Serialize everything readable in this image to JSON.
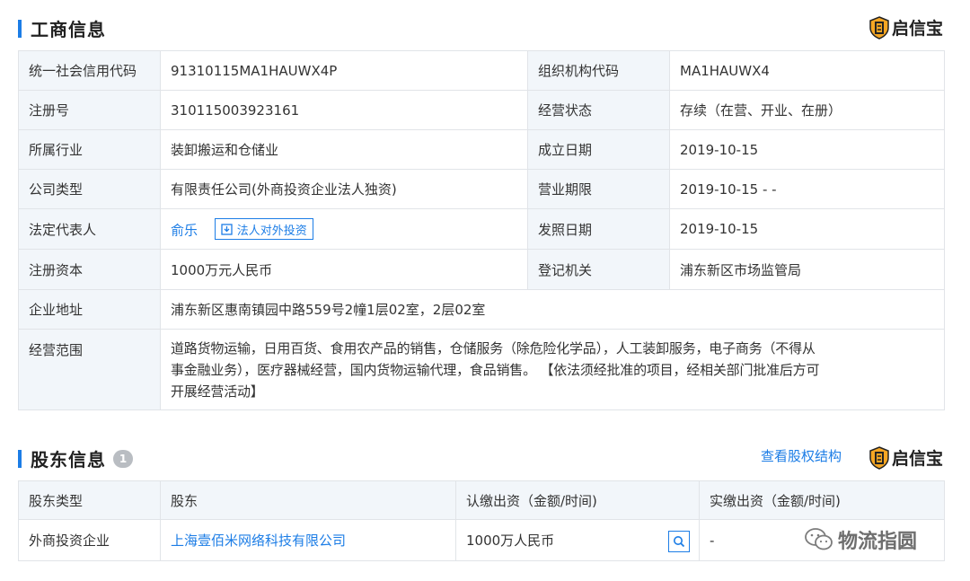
{
  "business": {
    "title": "工商信息",
    "brand": "启信宝",
    "rows": [
      {
        "l1": "统一社会信用代码",
        "v1": "91310115MA1HAUWX4P",
        "l2": "组织机构代码",
        "v2": "MA1HAUWX4"
      },
      {
        "l1": "注册号",
        "v1": "310115003923161",
        "l2": "经营状态",
        "v2": "存续（在营、开业、在册）"
      },
      {
        "l1": "所属行业",
        "v1": "装卸搬运和仓储业",
        "l2": "成立日期",
        "v2": "2019-10-15"
      },
      {
        "l1": "公司类型",
        "v1": "有限责任公司(外商投资企业法人独资)",
        "l2": "营业期限",
        "v2": "2019-10-15 - -"
      },
      {
        "l1": "法定代表人",
        "v1": "俞乐",
        "invest_label": "法人对外投资",
        "l2": "发照日期",
        "v2": "2019-10-15"
      },
      {
        "l1": "注册资本",
        "v1": "1000万元人民币",
        "l2": "登记机关",
        "v2": "浦东新区市场监管局"
      }
    ],
    "address_label": "企业地址",
    "address": "浦东新区惠南镇园中路559号2幢1层02室，2层02室",
    "scope_label": "经营范围",
    "scope_lines": [
      "道路货物运输，日用百货、食用农产品的销售，仓储服务（除危险化学品），人工装卸服务，电子商务（不得从",
      "事金融业务），医疗器械经营，国内货物运输代理，食品销售。 【依法须经批准的项目，经相关部门批准后方可",
      "开展经营活动】"
    ]
  },
  "shareholders": {
    "title": "股东信息",
    "count": "1",
    "view_structure": "查看股权结构",
    "brand": "启信宝",
    "headers": [
      "股东类型",
      "股东",
      "认缴出资（金额/时间)",
      "实缴出资（金额/时间)"
    ],
    "row": {
      "type": "外商投资企业",
      "name": "上海壹佰米网络科技有限公司",
      "subscribed": "1000万人民币",
      "paid": "-"
    }
  },
  "watermark": "物流指圆",
  "colors": {
    "accent": "#1c7de6",
    "label_bg": "#f2f6fa",
    "border": "#e1e4e8",
    "brand_icon": "#f5a623"
  }
}
